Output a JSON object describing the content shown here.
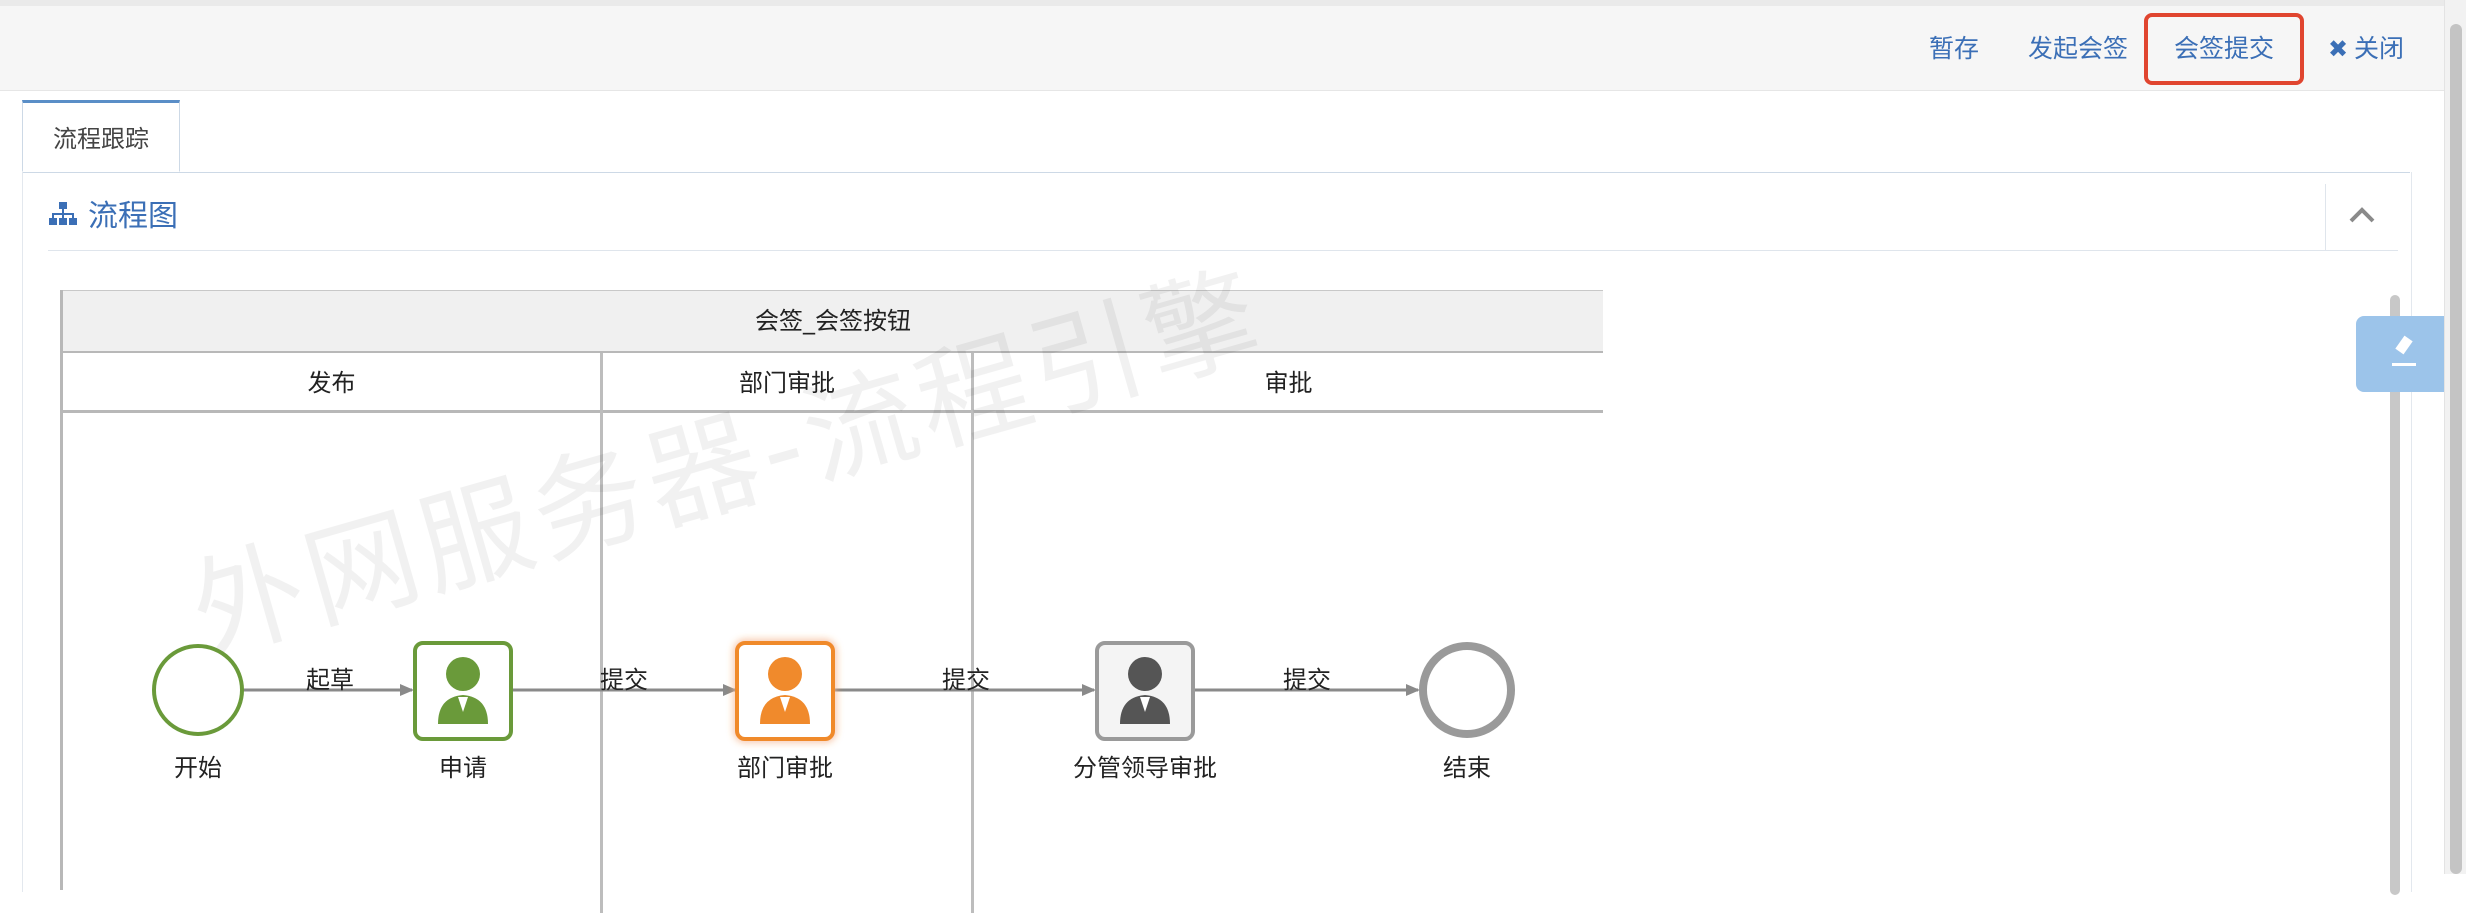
{
  "toolbar": {
    "save_draft": "暂存",
    "start_countersign": "发起会签",
    "submit_countersign": "会签提交",
    "close": "关闭",
    "highlight_color": "#e0452f"
  },
  "tabs": [
    {
      "label": "流程跟踪",
      "active": true
    }
  ],
  "panel": {
    "title": "流程图",
    "title_icon": "sitemap-icon",
    "collapse_icon": "chevron-up-icon"
  },
  "diagram": {
    "pool_title": "会签_会签按钮",
    "lanes": [
      "发布",
      "部门审批",
      "审批"
    ],
    "nodes": {
      "start": "开始",
      "apply": "申请",
      "dept_approve": "部门审批",
      "leader_approve": "分管领导审批",
      "end": "结束"
    },
    "edges": {
      "e1": "起草",
      "e2": "提交",
      "e3": "提交",
      "e4": "提交"
    },
    "colors": {
      "done": "#6a9a3a",
      "current": "#f08a2c",
      "pending": "#7d7d7d",
      "end": "#9a9a9a"
    }
  },
  "watermark": "外网服务器-流程引擎"
}
